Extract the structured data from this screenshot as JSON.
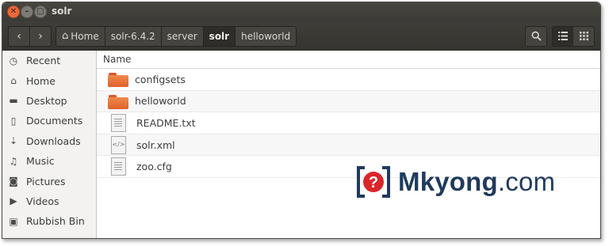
{
  "window": {
    "title": "solr"
  },
  "titlebar": {
    "close_glyph": "✕",
    "min_glyph": "–",
    "max_glyph": "▢"
  },
  "toolbar": {
    "back_glyph": "‹",
    "forward_glyph": "›",
    "breadcrumbs": [
      {
        "label": "Home",
        "icon": "home-icon"
      },
      {
        "label": "solr-6.4.2"
      },
      {
        "label": "server"
      },
      {
        "label": "solr",
        "active": true
      },
      {
        "label": "helloworld"
      }
    ],
    "search_icon": "search-icon",
    "list_view_icon": "list-view-icon",
    "grid_view_icon": "grid-view-icon"
  },
  "sidebar": {
    "items": [
      {
        "label": "Recent",
        "icon": "clock-icon",
        "glyph": "◷"
      },
      {
        "label": "Home",
        "icon": "home-icon",
        "glyph": "⌂"
      },
      {
        "label": "Desktop",
        "icon": "folder-icon",
        "glyph": "▬"
      },
      {
        "label": "Documents",
        "icon": "document-icon",
        "glyph": "▯"
      },
      {
        "label": "Downloads",
        "icon": "download-icon",
        "glyph": "⇣"
      },
      {
        "label": "Music",
        "icon": "music-icon",
        "glyph": "♫"
      },
      {
        "label": "Pictures",
        "icon": "camera-icon",
        "glyph": "◙"
      },
      {
        "label": "Videos",
        "icon": "video-icon",
        "glyph": "▶"
      },
      {
        "label": "Rubbish Bin",
        "icon": "trash-icon",
        "glyph": "▣"
      }
    ]
  },
  "main": {
    "column_header": "Name",
    "files": [
      {
        "name": "configsets",
        "type": "folder"
      },
      {
        "name": "helloworld",
        "type": "folder"
      },
      {
        "name": "README.txt",
        "type": "text"
      },
      {
        "name": "solr.xml",
        "type": "code"
      },
      {
        "name": "zoo.cfg",
        "type": "text"
      }
    ]
  },
  "watermark": {
    "brand": "Mkyong",
    "suffix": ".com",
    "mark_glyph": "?"
  },
  "colors": {
    "folder": "#e8703a",
    "titlebar": "#3c3b37",
    "brand": "#1f3b5e",
    "brand_accent": "#d9262b"
  }
}
